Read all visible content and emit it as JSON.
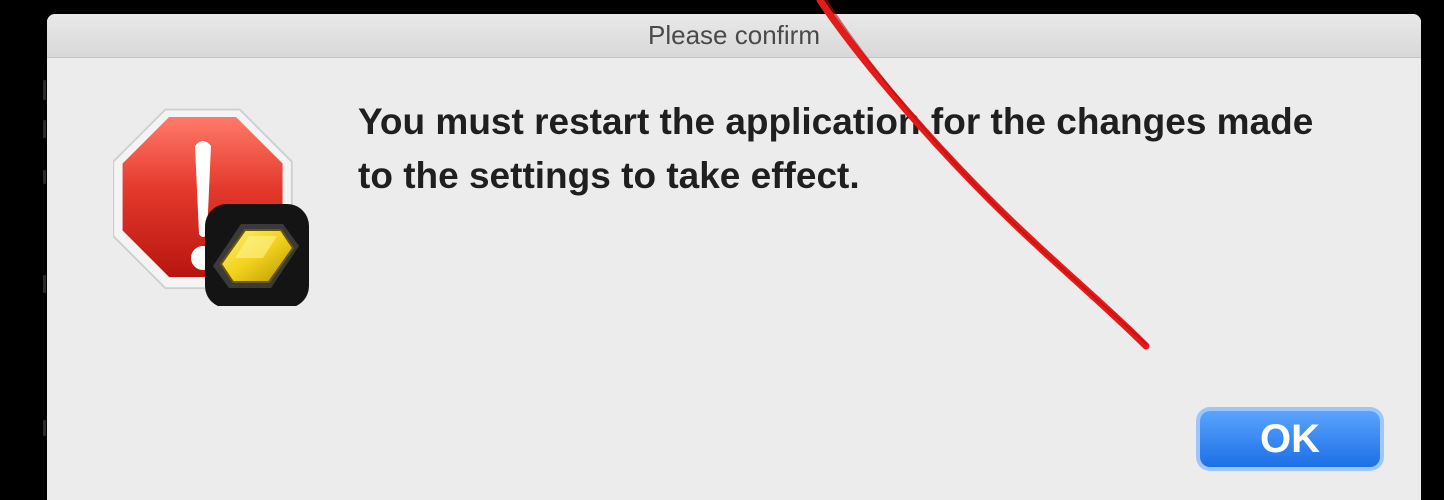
{
  "window": {
    "title": "Please confirm"
  },
  "alert": {
    "message": "You must restart the application for the changes made to the settings to take effect.",
    "icon": "stop-exclamation-icon",
    "badge_icon": "app-badge-icon"
  },
  "buttons": {
    "ok_label": "OK"
  },
  "colors": {
    "accent": "#1c6fe6",
    "stop_red": "#d8322a",
    "annotation": "#e31b1b",
    "badge_yellow": "#f2d21c"
  }
}
